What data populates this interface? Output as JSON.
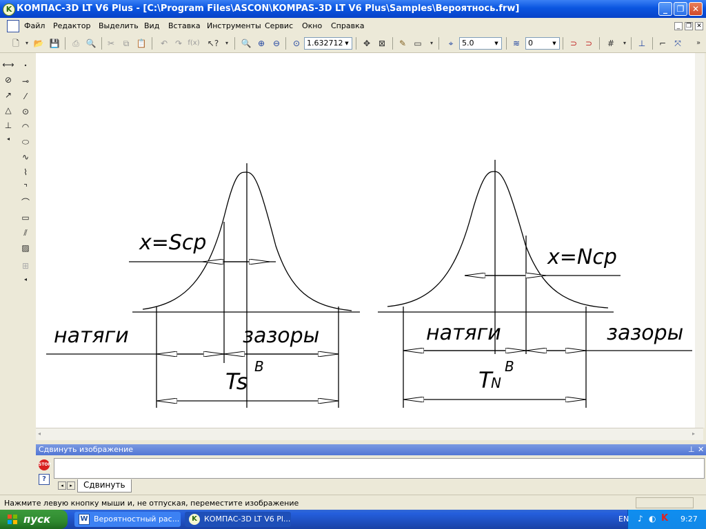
{
  "window": {
    "title": "КОМПАС-3D LT V6 Plus - [C:\\Program Files\\ASCON\\KOMPAS-3D LT V6 Plus\\Samples\\Вероятнось.frw]",
    "minimize": "_",
    "maximize": "❐",
    "close": "✕"
  },
  "menu": {
    "items": [
      "Файл",
      "Редактор",
      "Выделить",
      "Вид",
      "Вставка",
      "Инструменты",
      "Сервис",
      "Окно",
      "Справка"
    ]
  },
  "toolbar": {
    "zoom_value": "1.632712",
    "step_value": "5.0",
    "layer_value": "0"
  },
  "drawing": {
    "left": {
      "formula": "x=Scp",
      "label_left": "натяги",
      "label_right": "зазоры",
      "tolerance": "Ts",
      "superscript": "B"
    },
    "right": {
      "formula": "x=Ncp",
      "label_left": "натяги",
      "label_right": "зазоры",
      "tolerance": "T",
      "subscript": "N",
      "superscript": "B"
    }
  },
  "panel": {
    "title": "Сдвинуть изображение",
    "stop_label": "STOP",
    "help_label": "?",
    "tab_label": "Сдвинуть"
  },
  "status": {
    "message": "Нажмите левую кнопку мыши и, не отпуская, переместите изображение"
  },
  "taskbar": {
    "start_label": "пуск",
    "tasks": [
      "Вероятностный рас...",
      "КОМПАС-3D LT V6 Pl..."
    ],
    "language": "EN",
    "clock": "9:27"
  },
  "colors": {
    "titlebar": "#0a55e0",
    "taskbar": "#245edc",
    "start": "#2f8a2f"
  }
}
